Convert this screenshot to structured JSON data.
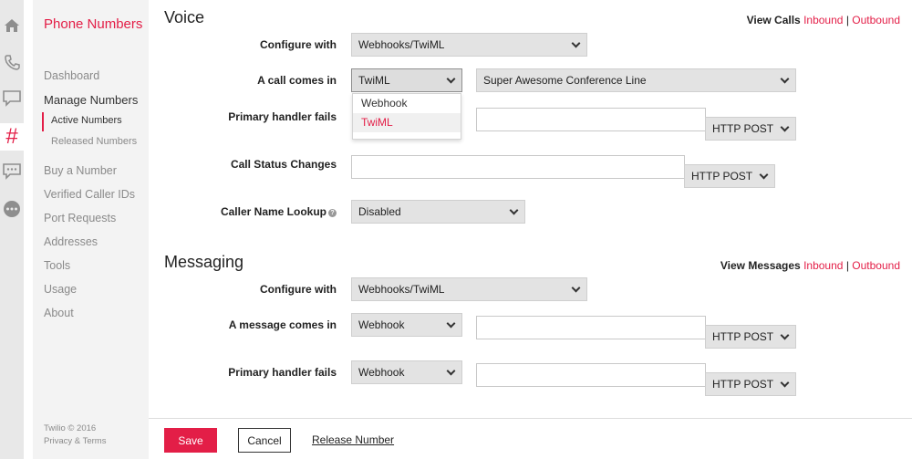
{
  "rail": {
    "icons": [
      "home-icon",
      "phone-icon",
      "chat-icon",
      "hash-icon",
      "message-dots-icon",
      "more-icon"
    ],
    "hash_glyph": "#"
  },
  "sidebar": {
    "title": "Phone Numbers",
    "items": [
      "Dashboard",
      "Manage Numbers",
      "Buy a Number",
      "Verified Caller IDs",
      "Port Requests",
      "Addresses",
      "Tools",
      "Usage",
      "About"
    ],
    "subitems": [
      "Active Numbers",
      "Released Numbers"
    ],
    "footer": [
      "Twilio © 2016",
      "Privacy & Terms"
    ]
  },
  "voice": {
    "title": "Voice",
    "view_label": "View Calls",
    "inbound": "Inbound",
    "separator": "|",
    "outbound": "Outbound",
    "configure_label": "Configure with",
    "configure_value": "Webhooks/TwiML",
    "call_comes_label": "A call comes in",
    "call_comes_value": "TwiML",
    "call_target_value": "Super Awesome Conference Line",
    "dropdown_options": [
      "Webhook",
      "TwiML"
    ],
    "primary_fails_label": "Primary handler fails",
    "primary_fails_method": "HTTP POST",
    "status_label": "Call Status Changes",
    "status_method": "HTTP POST",
    "cnam_label": "Caller Name Lookup",
    "cnam_help": "?",
    "cnam_value": "Disabled"
  },
  "messaging": {
    "title": "Messaging",
    "view_label": "View Messages",
    "inbound": "Inbound",
    "separator": "|",
    "outbound": "Outbound",
    "configure_label": "Configure with",
    "configure_value": "Webhooks/TwiML",
    "message_comes_label": "A message comes in",
    "message_comes_value": "Webhook",
    "message_method": "HTTP POST",
    "primary_fails_label": "Primary handler fails",
    "primary_fails_value": "Webhook",
    "primary_fails_method": "HTTP POST"
  },
  "footer": {
    "save": "Save",
    "cancel": "Cancel",
    "release": "Release Number"
  },
  "colors": {
    "accent": "#e31e47",
    "sidebar_bg": "#f3f3f3",
    "rail_bg": "#e8e8e8",
    "select_bg": "#e3e3e3"
  }
}
